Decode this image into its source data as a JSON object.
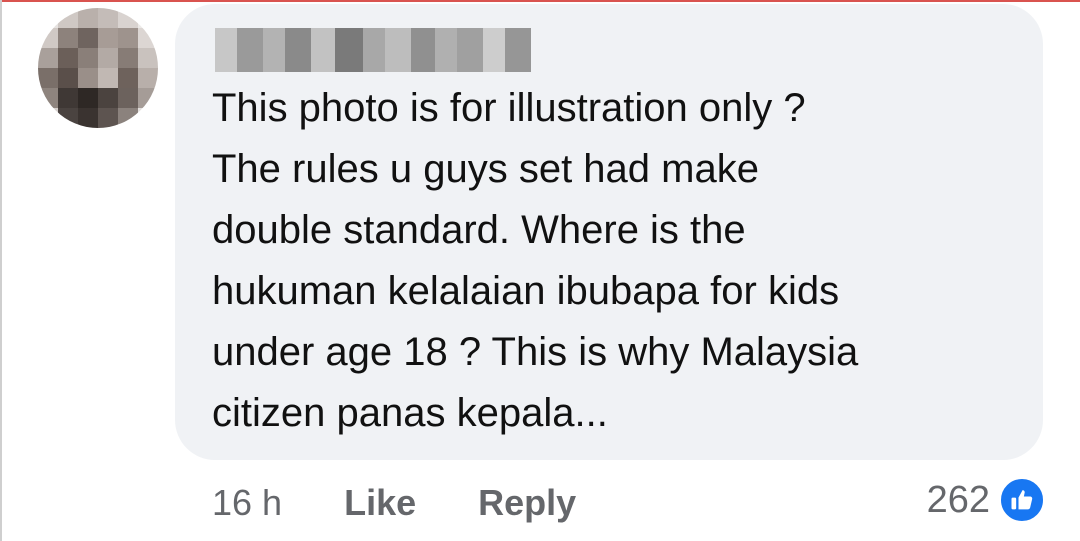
{
  "comment": {
    "text": "This photo is for illustration only ?\nThe rules u guys set had make\ndouble standard. Where is the\nhukuman kelalaian ibubapa for kids\nunder age 18 ? This is why Malaysia\ncitizen panas kepala..."
  },
  "actions": {
    "timestamp": "16 h",
    "like_label": "Like",
    "reply_label": "Reply"
  },
  "reactions": {
    "count": "262",
    "icon": "thumbs-up-icon",
    "color": "#1877f2"
  },
  "colors": {
    "bubble": "#f0f2f5",
    "text": "#111111",
    "muted": "#65676b"
  }
}
